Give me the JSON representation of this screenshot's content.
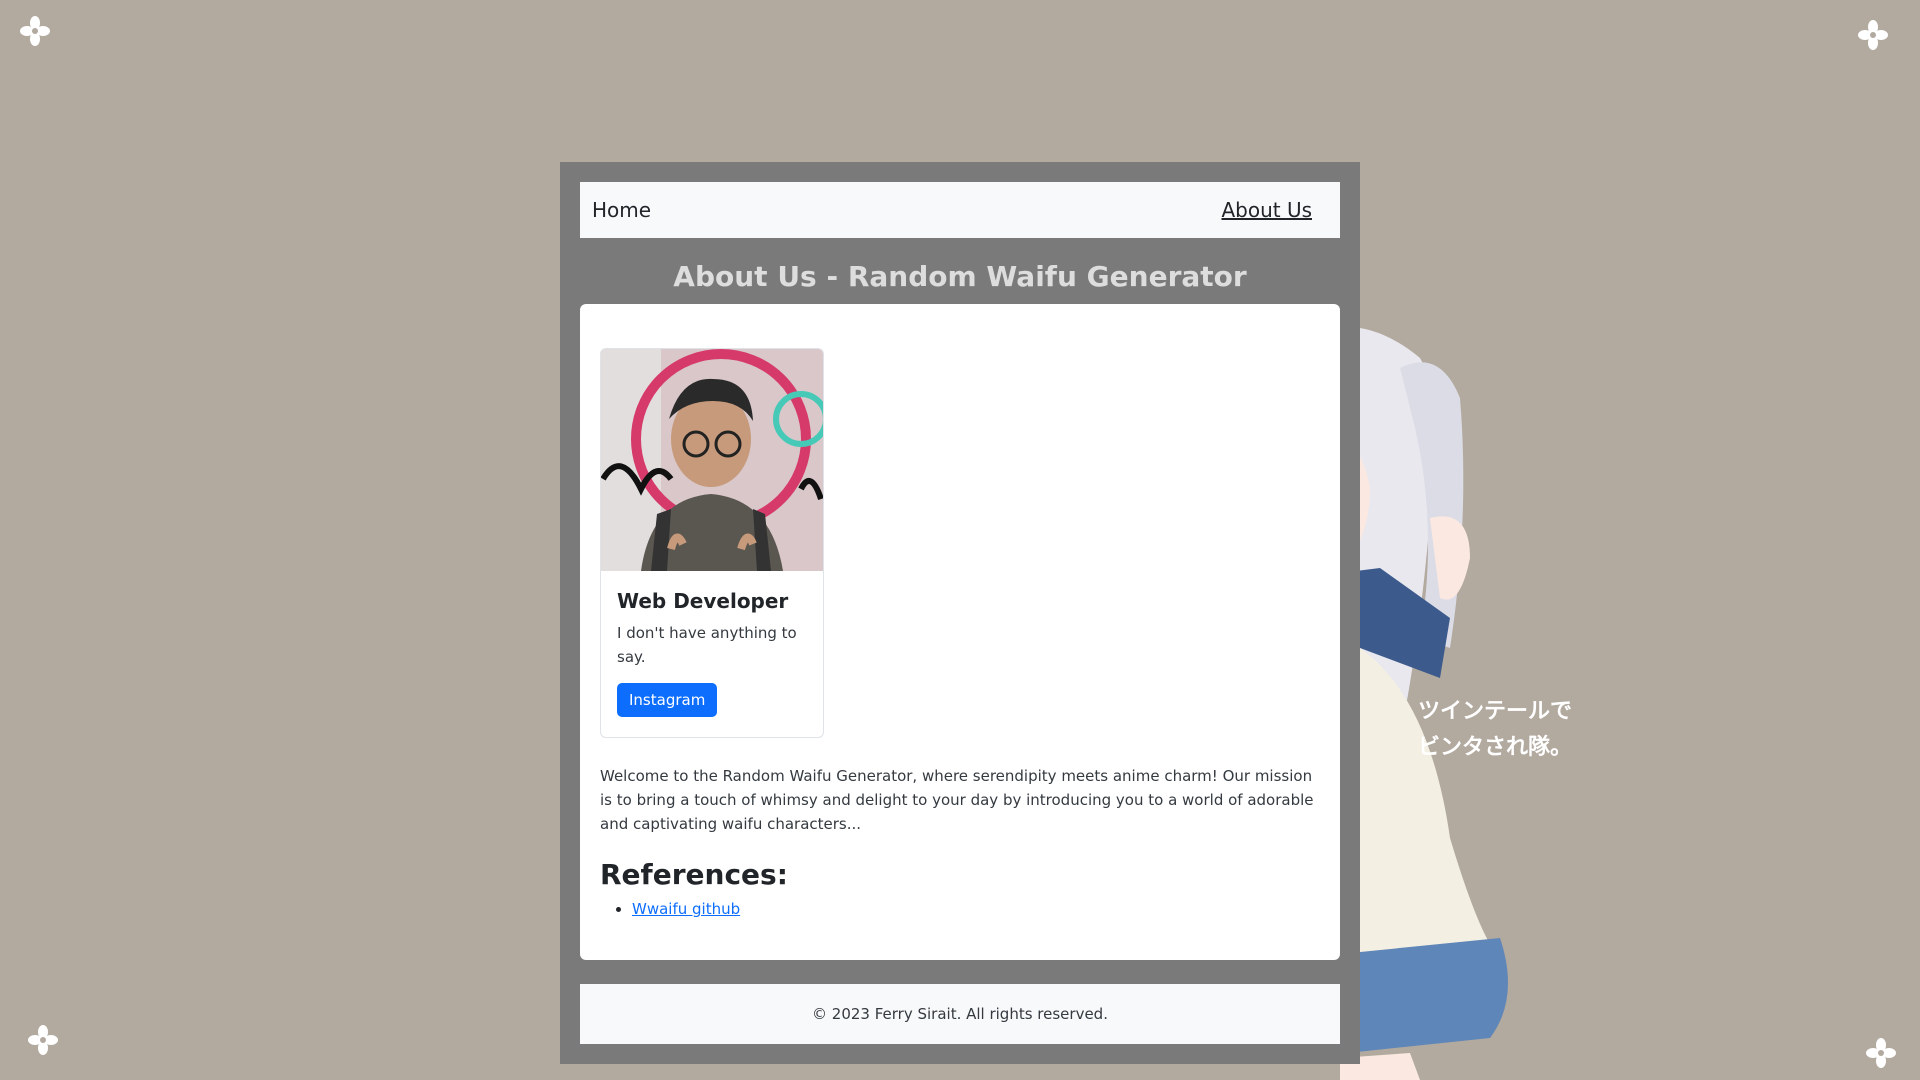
{
  "nav": {
    "home_label": "Home",
    "about_label": "About Us"
  },
  "page": {
    "title": "About Us - Random Waifu Generator"
  },
  "card": {
    "photo_icon": "profile-photo",
    "role": "Web Developer",
    "text": "I don't have anything to say.",
    "button_label": "Instagram"
  },
  "intro": "Welcome to the Random Waifu Generator, where serendipity meets anime charm! Our mission is to bring a touch of whimsy and delight to your day by introducing you to a world of adorable and captivating waifu characters...",
  "references": {
    "heading": "References:",
    "items": [
      {
        "label": "Wwaifu github"
      }
    ]
  },
  "footer": {
    "copyright": "© 2023 Ferry Sirait. All rights reserved."
  },
  "side_art_caption": [
    "ツインテールで",
    "ビンタされ隊。"
  ],
  "colors": {
    "background": "#b2a99f",
    "container": "#7a7a7a",
    "accent": "#0d6efd",
    "title": "#dddddd"
  },
  "icons": [
    "flower-icon",
    "profile-photo",
    "anime-girl-illustration"
  ]
}
